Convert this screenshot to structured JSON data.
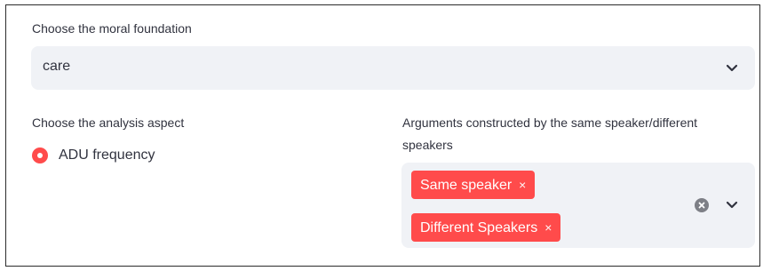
{
  "foundation": {
    "label": "Choose the moral foundation",
    "selected": "care"
  },
  "aspect": {
    "label": "Choose the analysis aspect",
    "options": [
      {
        "label": "ADU frequency",
        "selected": true
      }
    ]
  },
  "speakers": {
    "label_line1": "Arguments constructed by the same speaker/different",
    "label_line2": "speakers",
    "tags": [
      "Same speaker",
      "Different Speakers"
    ],
    "remove_glyph": "×"
  },
  "colors": {
    "accent": "#ff4b4b",
    "field_bg": "#f0f2f6",
    "text": "#31333f"
  },
  "icons": {
    "dropdown": "chevron-down-icon",
    "clear": "clear-all-icon",
    "radio": "radio-selected-icon",
    "remove": "close-icon"
  }
}
